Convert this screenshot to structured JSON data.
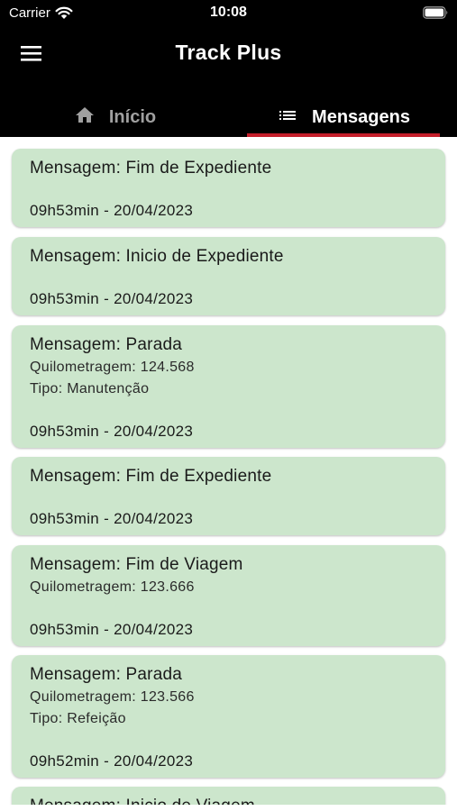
{
  "status_bar": {
    "carrier": "Carrier",
    "time": "10:08"
  },
  "app": {
    "title": "Track Plus"
  },
  "tabs": [
    {
      "label": "Início",
      "icon": "home-icon",
      "active": false
    },
    {
      "label": "Mensagens",
      "icon": "list-icon",
      "active": true
    }
  ],
  "colors": {
    "header_bg": "#000000",
    "card_bg": "#cce6cc",
    "tab_indicator": "#c41e2a",
    "inactive_tab": "#a0a0a0"
  },
  "messages": [
    {
      "title": "Mensagem: Fim de Expediente",
      "timestamp": "09h53min - 20/04/2023"
    },
    {
      "title": "Mensagem: Inicio de Expediente",
      "timestamp": "09h53min - 20/04/2023"
    },
    {
      "title": "Mensagem: Parada",
      "line1": "Quilometragem: 124.568",
      "line2": "Tipo: Manutenção",
      "timestamp": "09h53min - 20/04/2023"
    },
    {
      "title": "Mensagem: Fim de Expediente",
      "timestamp": "09h53min - 20/04/2023"
    },
    {
      "title": "Mensagem: Fim de Viagem",
      "line1": "Quilometragem: 123.666",
      "timestamp": "09h53min - 20/04/2023"
    },
    {
      "title": "Mensagem: Parada",
      "line1": "Quilometragem: 123.566",
      "line2": "Tipo: Refeição",
      "timestamp": "09h52min - 20/04/2023"
    },
    {
      "title": "Mensagem: Inicio de Viagem"
    }
  ]
}
